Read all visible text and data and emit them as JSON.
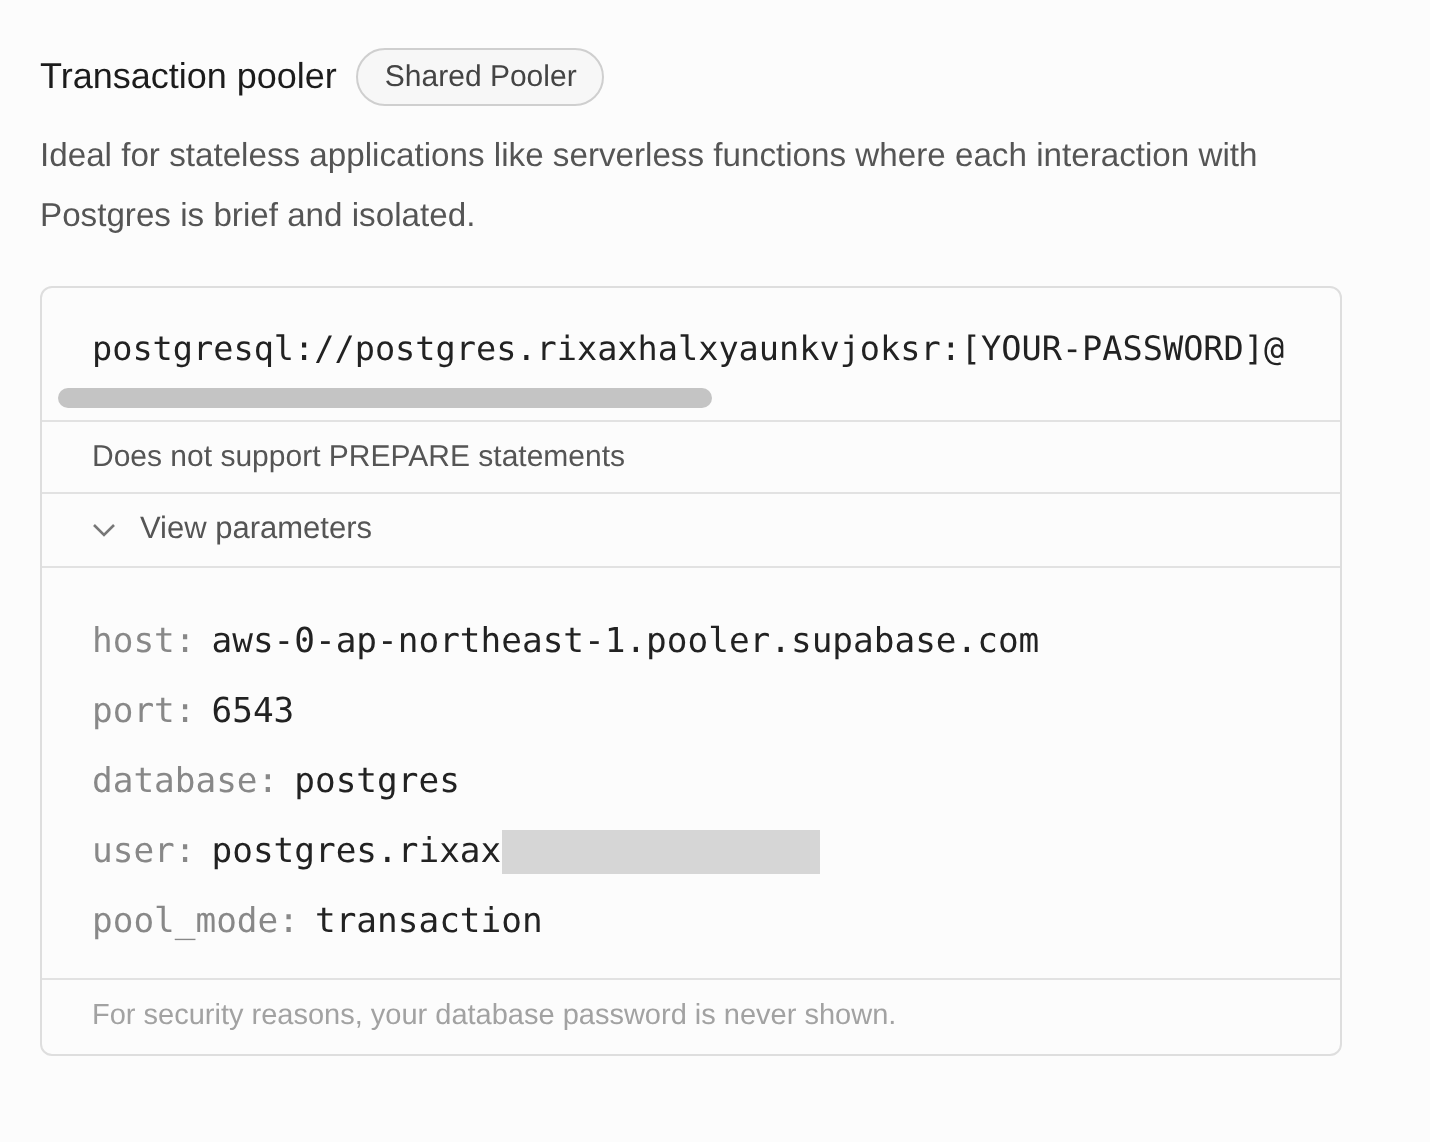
{
  "header": {
    "title": "Transaction pooler",
    "badge": "Shared Pooler"
  },
  "description": "Ideal for stateless applications like serverless functions where each interaction with Postgres is brief and isolated.",
  "connection_string": "postgresql://postgres.rixaxhalxyaunkvjoksr:[YOUR-PASSWORD]@",
  "note": "Does not support PREPARE statements",
  "parameters_toggle": {
    "label": "View parameters",
    "expanded": true
  },
  "parameters": [
    {
      "key": "host:",
      "value": "aws-0-ap-northeast-1.pooler.supabase.com",
      "redacted": false
    },
    {
      "key": "port:",
      "value": "6543",
      "redacted": false
    },
    {
      "key": "database:",
      "value": "postgres",
      "redacted": false
    },
    {
      "key": "user:",
      "value": "postgres.rixax",
      "redacted": true
    },
    {
      "key": "pool_mode:",
      "value": "transaction",
      "redacted": false
    }
  ],
  "footer": "For security reasons, your database password is never shown."
}
